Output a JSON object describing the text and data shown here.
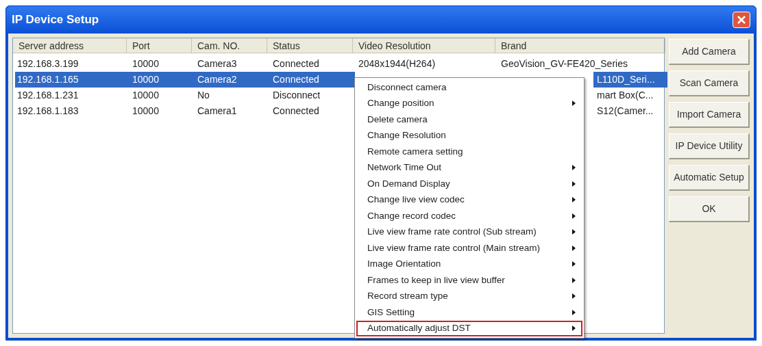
{
  "window": {
    "title": "IP Device Setup"
  },
  "table": {
    "columns": [
      "Server address",
      "Port",
      "Cam. NO.",
      "Status",
      "Video Resolution",
      "Brand"
    ],
    "rows": [
      {
        "selected": false,
        "server_address": "192.168.3.199",
        "port": "10000",
        "cam_no": "Camera3",
        "status": "Connected",
        "video_resolution": "2048x1944(H264)",
        "brand": "GeoVision_GV-FE420_Series",
        "brand_covered": false
      },
      {
        "selected": true,
        "server_address": "192.168.1.165",
        "port": "10000",
        "cam_no": "Camera2",
        "status": "Connected",
        "brand": "L110D_Seri...",
        "brand_covered": true
      },
      {
        "selected": false,
        "server_address": "192.168.1.231",
        "port": "10000",
        "cam_no": "No",
        "status": "Disconnect",
        "brand": "mart Box(C...",
        "brand_covered": true
      },
      {
        "selected": false,
        "server_address": "192.168.1.183",
        "port": "10000",
        "cam_no": "Camera1",
        "status": "Connected",
        "brand": "S12(Camer...",
        "brand_covered": true
      }
    ]
  },
  "buttons": [
    "Add Camera",
    "Scan Camera",
    "Import Camera",
    "IP Device Utility",
    "Automatic Setup",
    "OK"
  ],
  "context_menu": [
    {
      "label": "Disconnect camera",
      "submenu": false,
      "selected": false
    },
    {
      "label": "Change position",
      "submenu": true,
      "selected": false
    },
    {
      "label": "Delete camera",
      "submenu": false,
      "selected": false
    },
    {
      "label": "Change Resolution",
      "submenu": false,
      "selected": false
    },
    {
      "label": "Remote camera setting",
      "submenu": false,
      "selected": false
    },
    {
      "label": "Network Time Out",
      "submenu": true,
      "selected": false
    },
    {
      "label": "On Demand Display",
      "submenu": true,
      "selected": false
    },
    {
      "label": "Change live view codec",
      "submenu": true,
      "selected": false
    },
    {
      "label": "Change record codec",
      "submenu": true,
      "selected": false
    },
    {
      "label": "Live view frame rate control (Sub stream)",
      "submenu": true,
      "selected": false
    },
    {
      "label": "Live view frame rate control (Main stream)",
      "submenu": true,
      "selected": false
    },
    {
      "label": "Image Orientation",
      "submenu": true,
      "selected": false
    },
    {
      "label": "Frames to keep in live view buffer",
      "submenu": true,
      "selected": false
    },
    {
      "label": "Record stream type",
      "submenu": true,
      "selected": false
    },
    {
      "label": "GIS Setting",
      "submenu": true,
      "selected": false
    },
    {
      "label": "Automatically adjust DST",
      "submenu": true,
      "selected": true
    }
  ]
}
